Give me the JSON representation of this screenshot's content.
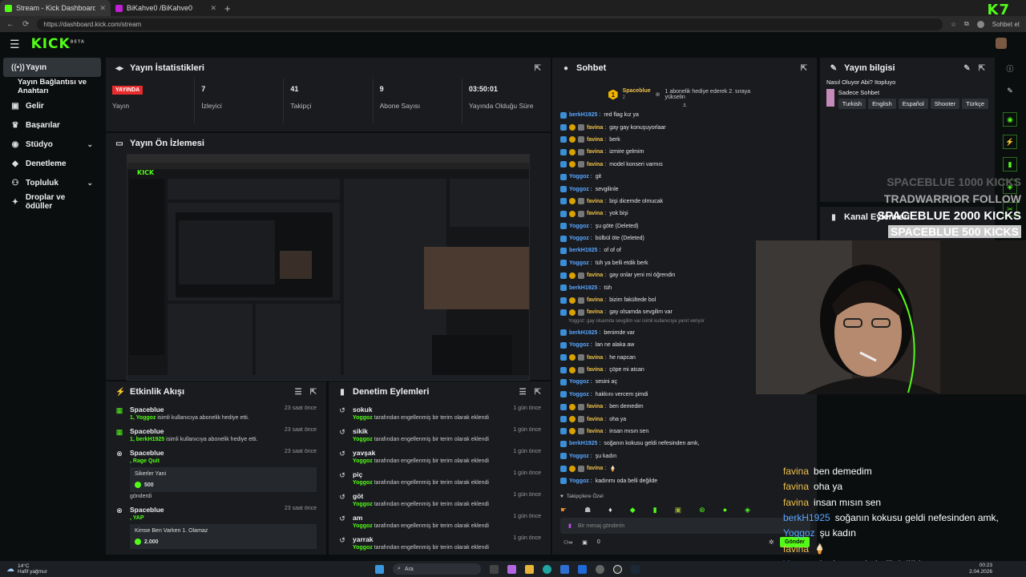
{
  "browser": {
    "tabs": [
      {
        "title": "Stream - Kick Dashboard",
        "favicon_color": "#53fc18",
        "active": true
      },
      {
        "title": "BiKahve0 /BiKahve0",
        "favicon_color": "#c21fd6",
        "active": false
      }
    ],
    "url": "https://dashboard.kick.com/stream",
    "profile_label": "Sohbet et"
  },
  "brand_mark": "K7",
  "app": {
    "logo": "KICK",
    "logo_sup": "BETA"
  },
  "sidebar": {
    "items": [
      {
        "label": "Yayın",
        "icon": "broadcast-icon",
        "glyph": "((•))",
        "active": true
      },
      {
        "label": "Yayın Bağlantısı ve Anahtarı",
        "icon": "",
        "glyph": "",
        "sub": true
      },
      {
        "label": "Gelir",
        "icon": "wallet-icon",
        "glyph": "▣"
      },
      {
        "label": "Başarılar",
        "icon": "trophy-icon",
        "glyph": "🏆"
      },
      {
        "label": "Stüdyo",
        "icon": "studio-icon",
        "glyph": "◉",
        "chevron": true
      },
      {
        "label": "Denetleme",
        "icon": "shield-icon",
        "glyph": "◆"
      },
      {
        "label": "Topluluk",
        "icon": "community-icon",
        "glyph": "👥",
        "chevron": true
      },
      {
        "label": "Droplar ve ödüller",
        "icon": "gift-icon",
        "glyph": "🎁"
      }
    ]
  },
  "stats_panel": {
    "title": "Yayın İstatistikleri",
    "live_badge": "YAYINDA",
    "stats": [
      {
        "value": "",
        "label": "Yayın"
      },
      {
        "value": "7",
        "label": "İzleyici"
      },
      {
        "value": "41",
        "label": "Takipçi"
      },
      {
        "value": "9",
        "label": "Abone Sayısı"
      },
      {
        "value": "03:50:01",
        "label": "Yayında Olduğu Süre"
      }
    ]
  },
  "preview_panel": {
    "title": "Yayın Ön İzlemesi"
  },
  "activity_panel": {
    "title": "Etkinlik Akışı",
    "items": [
      {
        "name": "Spaceblue",
        "time": "23 saat önce",
        "hl": "1, Yoggoz",
        "rest": " isimli kullanıcıya abonelik hediye etti."
      },
      {
        "name": "Spaceblue",
        "time": "23 saat önce",
        "hl": "1, berkH1925",
        "rest": " isimli kullanıcıya abonelik hediye etti."
      },
      {
        "name": "Spaceblue",
        "time": "23 saat önce",
        "hl": ", Rage Quit",
        "rest": "",
        "card_title": "Sikerler Yani",
        "amount": "500",
        "footer": "gönderdi"
      },
      {
        "name": "Spaceblue",
        "time": "23 saat önce",
        "hl": ", YAP",
        "rest": "",
        "card_title": "Kimse Ben Varken 1. Olamaz",
        "amount": "2.000"
      }
    ]
  },
  "moderation_panel": {
    "title": "Denetim Eylemleri",
    "items": [
      {
        "term": "sokuk",
        "time": "1 gün önce"
      },
      {
        "term": "sikik",
        "time": "1 gün önce"
      },
      {
        "term": "yavşak",
        "time": "1 gün önce"
      },
      {
        "term": "piç",
        "time": "1 gün önce"
      },
      {
        "term": "göt",
        "time": "1 gün önce"
      },
      {
        "term": "am",
        "time": "1 gün önce"
      },
      {
        "term": "yarrak",
        "time": "1 gün önce"
      }
    ],
    "actor": "Yoggoz",
    "action_text": " tarafından engellenmiş bir terim olarak eklendi"
  },
  "chat": {
    "title": "Sohbet",
    "pinned": {
      "rank": "1",
      "user": "Spaceblue",
      "count": "2",
      "text": "1 abonelik hediye ederek 2. sıraya yükselin"
    },
    "messages": [
      {
        "user": "berkH1925",
        "color": "blue",
        "text": "red flag kız ya",
        "badges": 1
      },
      {
        "user": "favina",
        "color": "gold",
        "text": "gay gay konuşuyorlaar",
        "badges": 3
      },
      {
        "user": "favina",
        "color": "gold",
        "text": "berk",
        "badges": 3
      },
      {
        "user": "favina",
        "color": "gold",
        "text": "izmire gelmim",
        "badges": 3
      },
      {
        "user": "favina",
        "color": "gold",
        "text": "model konseri varmıs",
        "badges": 3
      },
      {
        "user": "Yoggoz",
        "color": "blue",
        "text": "git",
        "badges": 1
      },
      {
        "user": "Yoggoz",
        "color": "blue",
        "text": "sevgilinle",
        "badges": 1
      },
      {
        "user": "favina",
        "color": "gold",
        "text": "bişi dicemde olmucak",
        "badges": 3
      },
      {
        "user": "favina",
        "color": "gold",
        "text": "yok bişi",
        "badges": 3
      },
      {
        "user": "Yoggoz",
        "color": "blue",
        "text": "şu göte (Deleted)",
        "badges": 1
      },
      {
        "user": "Yoggoz",
        "color": "blue",
        "text": "bülbül öte (Deleted)",
        "badges": 1
      },
      {
        "user": "berkH1925",
        "color": "blue",
        "text": "of of of",
        "badges": 1
      },
      {
        "user": "Yoggoz",
        "color": "blue",
        "text": "tüh ya belli etdik berk",
        "badges": 1
      },
      {
        "user": "favina",
        "color": "gold",
        "text": "gay onlar yeni mi öğrendin",
        "badges": 3
      },
      {
        "user": "berkH1925",
        "color": "blue",
        "text": "tüh",
        "badges": 1
      },
      {
        "user": "favina",
        "color": "gold",
        "text": "bizim fakültede bol",
        "badges": 3
      },
      {
        "user": "favina",
        "color": "gold",
        "text": "gay olsamda sevgilim var",
        "badges": 3
      }
    ],
    "system_note": "Yoggoz: gay olsamda sevgilim var isimli kullanıcıya yanıt veriyor",
    "messages2": [
      {
        "user": "berkH1925",
        "color": "blue",
        "text": "benimde var",
        "badges": 1
      },
      {
        "user": "Yoggoz",
        "color": "blue",
        "text": "lan ne alaka aw",
        "badges": 1
      },
      {
        "user": "favina",
        "color": "gold",
        "text": "he napcan",
        "badges": 3
      },
      {
        "user": "favina",
        "color": "gold",
        "text": "çöpe mi atcan",
        "badges": 3
      },
      {
        "user": "Yoggoz",
        "color": "blue",
        "text": "sesini aç",
        "badges": 1
      },
      {
        "user": "Yoggoz",
        "color": "blue",
        "text": "hakkını vercem şimdi",
        "badges": 1
      },
      {
        "user": "favina",
        "color": "gold",
        "text": "ben demedim",
        "badges": 3
      },
      {
        "user": "favina",
        "color": "gold",
        "text": "oha ya",
        "badges": 3
      },
      {
        "user": "favina",
        "color": "gold",
        "text": "insan mısın sen",
        "badges": 3
      },
      {
        "user": "berkH1925",
        "color": "blue",
        "text": "soğanın kokusu geldi nefesinden amk,",
        "badges": 1
      },
      {
        "user": "Yoggoz",
        "color": "blue",
        "text": "şu kadın",
        "badges": 1
      },
      {
        "user": "favina",
        "color": "gold",
        "text": "🍦",
        "badges": 3
      },
      {
        "user": "Yoggoz",
        "color": "blue",
        "text": "kadınmı oda belli değilde",
        "badges": 1
      }
    ],
    "mode_label": "Takipçilere Özel",
    "input_placeholder": "Bir mesaj gönderin",
    "counter": "0",
    "send_label": "Gönder"
  },
  "stream_info": {
    "title": "Yayın bilgisi",
    "stream_title": "Nasıl Oluyor Abi? Itopluyo",
    "category": "Sadece Sohbet",
    "tags": [
      "Turkish",
      "English",
      "Español",
      "Shooter",
      "Türkçe"
    ]
  },
  "channel_panel": {
    "title": "Kanal Eylemleri"
  },
  "overlay": {
    "kick_events": [
      {
        "text": "SPACEBLUE  1000 KICKS",
        "color": "#5c5c5c"
      },
      {
        "text": "TRADWARRIOR  FOLLOW",
        "color": "#a9a9a9"
      },
      {
        "text": "SPACEBLUE  2000 KICKS",
        "color": "#ffffff"
      },
      {
        "text": "SPACEBLUE  500 KICKS",
        "color": "#ffffff"
      }
    ],
    "chat": [
      {
        "user": "favina",
        "color": "#f0c14a",
        "text": "ben demedim"
      },
      {
        "user": "favina",
        "color": "#f0c14a",
        "text": "oha ya"
      },
      {
        "user": "favina",
        "color": "#f0c14a",
        "text": "insan mısın sen"
      },
      {
        "user": "berkH1925",
        "color": "#5aa6ff",
        "text": "soğanın kokusu geldi nefesinden amk,"
      },
      {
        "user": "Yoggoz",
        "color": "#5aa6ff",
        "text": "şu kadın"
      },
      {
        "user": "favina",
        "color": "#f0c14a",
        "text": "🍦"
      },
      {
        "user": "Yoggoz",
        "color": "#5aa6ff",
        "text": "kadınmı oda belli değilde"
      }
    ]
  },
  "taskbar": {
    "temp": "14°C",
    "weather": "Hafif yağmur",
    "search": "Ara",
    "time": "00:23",
    "date": "2.04.2026"
  },
  "colors": {
    "accent": "#53fc18",
    "live": "#e62c2c",
    "panel": "#191b1f"
  }
}
